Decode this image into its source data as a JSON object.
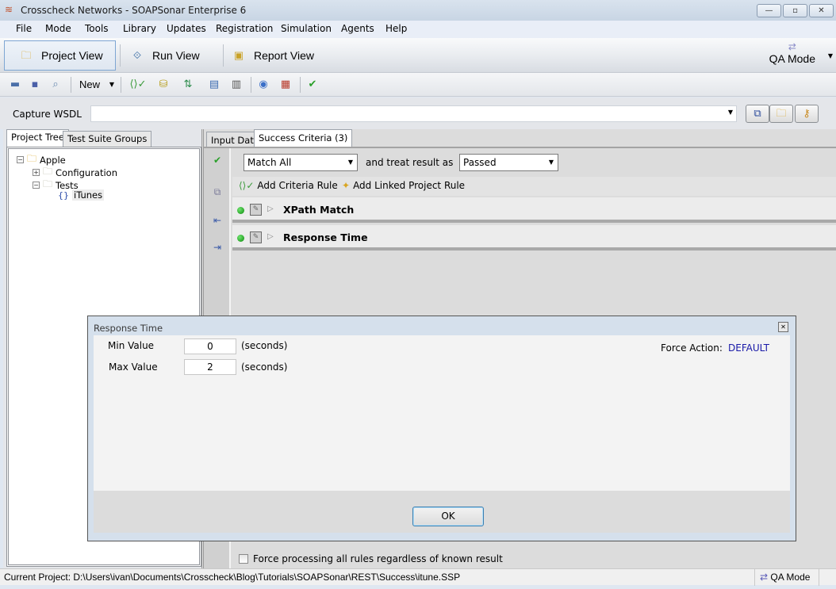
{
  "window": {
    "title": "Crosscheck Networks - SOAPSonar Enterprise 6",
    "controls": {
      "minimize": "▭",
      "maximize": "⧠",
      "close": "✕"
    }
  },
  "menu": [
    "File",
    "Mode",
    "Tools",
    "Library",
    "Updates",
    "Registration",
    "Simulation",
    "Agents",
    "Help"
  ],
  "views": [
    {
      "label": "Project View",
      "icon": "project-view-icon",
      "active": true
    },
    {
      "label": "Run View",
      "icon": "run-view-icon",
      "active": false
    },
    {
      "label": "Report View",
      "icon": "report-view-icon",
      "active": false
    }
  ],
  "mode_switch": {
    "label": "QA Mode"
  },
  "toolbar": {
    "new_label": "New",
    "icons": [
      "open-folder-icon",
      "save-icon",
      "search-icon",
      "criteria-icon",
      "database-icon",
      "sort-icon",
      "form-icon",
      "columns-icon",
      "globe-icon",
      "grid-icon",
      "check-icon"
    ]
  },
  "capture": {
    "label": "Capture WSDL",
    "value": ""
  },
  "left_panel": {
    "tabs": [
      "Project Tree",
      "Test Suite Groups"
    ],
    "active_tab": 0,
    "tree": [
      {
        "label": "Apple",
        "level": 0,
        "expander": "−"
      },
      {
        "label": "Configuration",
        "level": 1,
        "expander": "+"
      },
      {
        "label": "Tests",
        "level": 1,
        "expander": "−"
      },
      {
        "label": "iTunes",
        "level": 2,
        "expander": ""
      }
    ]
  },
  "right_panel": {
    "tabs": [
      "Input Data",
      "Success Criteria (3)"
    ],
    "active_tab": 1,
    "match_select": "Match All",
    "treat_label": "and treat result as",
    "result_select": "Passed",
    "add_rule": "Add Criteria Rule",
    "add_linked_rule": "Add Linked Project Rule",
    "rules": [
      {
        "name": "XPath Match",
        "status": "green"
      },
      {
        "name": "Response Time",
        "status": "green"
      }
    ],
    "force_processing": {
      "label": "Force processing all rules regardless of known result",
      "checked": false
    }
  },
  "dialog": {
    "title": "Response Time",
    "min_label": "Min Value",
    "min_value": "0",
    "max_label": "Max Value",
    "max_value": "2",
    "unit": "(seconds)",
    "force_action_label": "Force Action:",
    "force_action_value": "DEFAULT",
    "ok_label": "OK"
  },
  "status": {
    "path": "Current Project: D:\\Users\\ivan\\Documents\\Crosscheck\\Blog\\Tutorials\\SOAPSonar\\REST\\Success\\itune.SSP",
    "mode": "QA Mode"
  },
  "colors": {
    "force_action": "#1a1aa8",
    "ok_border": "#3c7fb1",
    "status_green": "#0a8a0a"
  }
}
